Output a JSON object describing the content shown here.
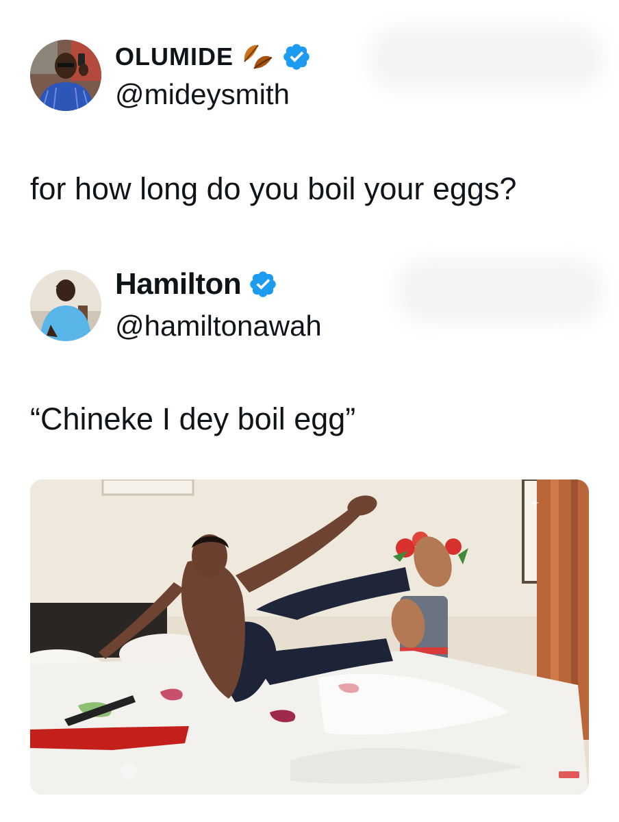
{
  "tweets": [
    {
      "display_name": "OLUMIDE",
      "handle": "@mideysmith",
      "text": "for how long do you boil your eggs?",
      "emoji_icon": "fallen-leaf-icon",
      "verified": true
    },
    {
      "display_name": "Hamilton",
      "handle": "@hamiltonawah",
      "text": "“Chineke I dey boil egg”",
      "verified": true
    }
  ],
  "colors": {
    "verified_blue": "#1d9bf0",
    "text": "#0f1419"
  }
}
